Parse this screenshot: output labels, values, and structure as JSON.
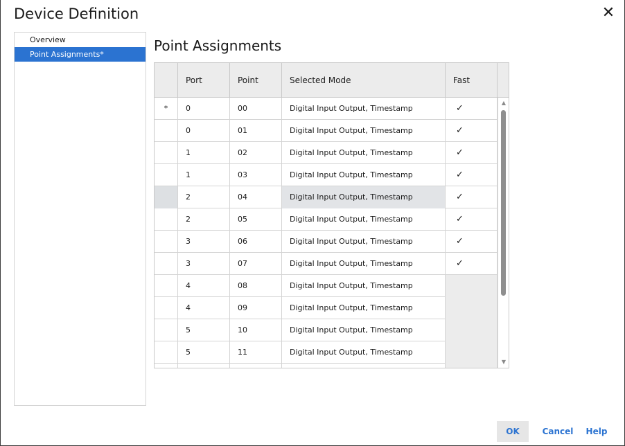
{
  "dialog": {
    "title": "Device Definition",
    "close_glyph": "✕"
  },
  "nav": {
    "items": [
      {
        "label": "Overview",
        "selected": false
      },
      {
        "label": "Point Assignments*",
        "selected": true
      }
    ]
  },
  "section": {
    "title": "Point Assignments"
  },
  "grid": {
    "columns": [
      "",
      "Port",
      "Point",
      "Selected Mode",
      "Fast"
    ],
    "rows": [
      {
        "marker": "*",
        "port": "0",
        "point": "00",
        "mode": "Digital Input Output, Timestamp",
        "fast": "✓"
      },
      {
        "marker": "",
        "port": "0",
        "point": "01",
        "mode": "Digital Input Output, Timestamp",
        "fast": "✓"
      },
      {
        "marker": "",
        "port": "1",
        "point": "02",
        "mode": "Digital Input Output, Timestamp",
        "fast": "✓"
      },
      {
        "marker": "",
        "port": "1",
        "point": "03",
        "mode": "Digital Input Output, Timestamp",
        "fast": "✓"
      },
      {
        "marker": "",
        "port": "2",
        "point": "04",
        "mode": "Digital Input Output, Timestamp",
        "fast": "✓"
      },
      {
        "marker": "",
        "port": "2",
        "point": "05",
        "mode": "Digital Input Output, Timestamp",
        "fast": "✓"
      },
      {
        "marker": "",
        "port": "3",
        "point": "06",
        "mode": "Digital Input Output, Timestamp",
        "fast": "✓"
      },
      {
        "marker": "",
        "port": "3",
        "point": "07",
        "mode": "Digital Input Output, Timestamp",
        "fast": "✓"
      },
      {
        "marker": "",
        "port": "4",
        "point": "08",
        "mode": "Digital Input Output, Timestamp",
        "fast": ""
      },
      {
        "marker": "",
        "port": "4",
        "point": "09",
        "mode": "Digital Input Output, Timestamp",
        "fast": ""
      },
      {
        "marker": "",
        "port": "5",
        "point": "10",
        "mode": "Digital Input Output, Timestamp",
        "fast": ""
      },
      {
        "marker": "",
        "port": "5",
        "point": "11",
        "mode": "Digital Input Output, Timestamp",
        "fast": ""
      },
      {
        "marker": "",
        "port": "",
        "point": "",
        "mode": "",
        "fast": ""
      }
    ],
    "selected_row": 4
  },
  "footer": {
    "ok_label": "OK",
    "cancel_label": "Cancel",
    "help_label": "Help"
  },
  "colors": {
    "accent": "#2b73d1",
    "header_bg": "#ececec",
    "selected_row_bg": "#e2e4e7"
  }
}
